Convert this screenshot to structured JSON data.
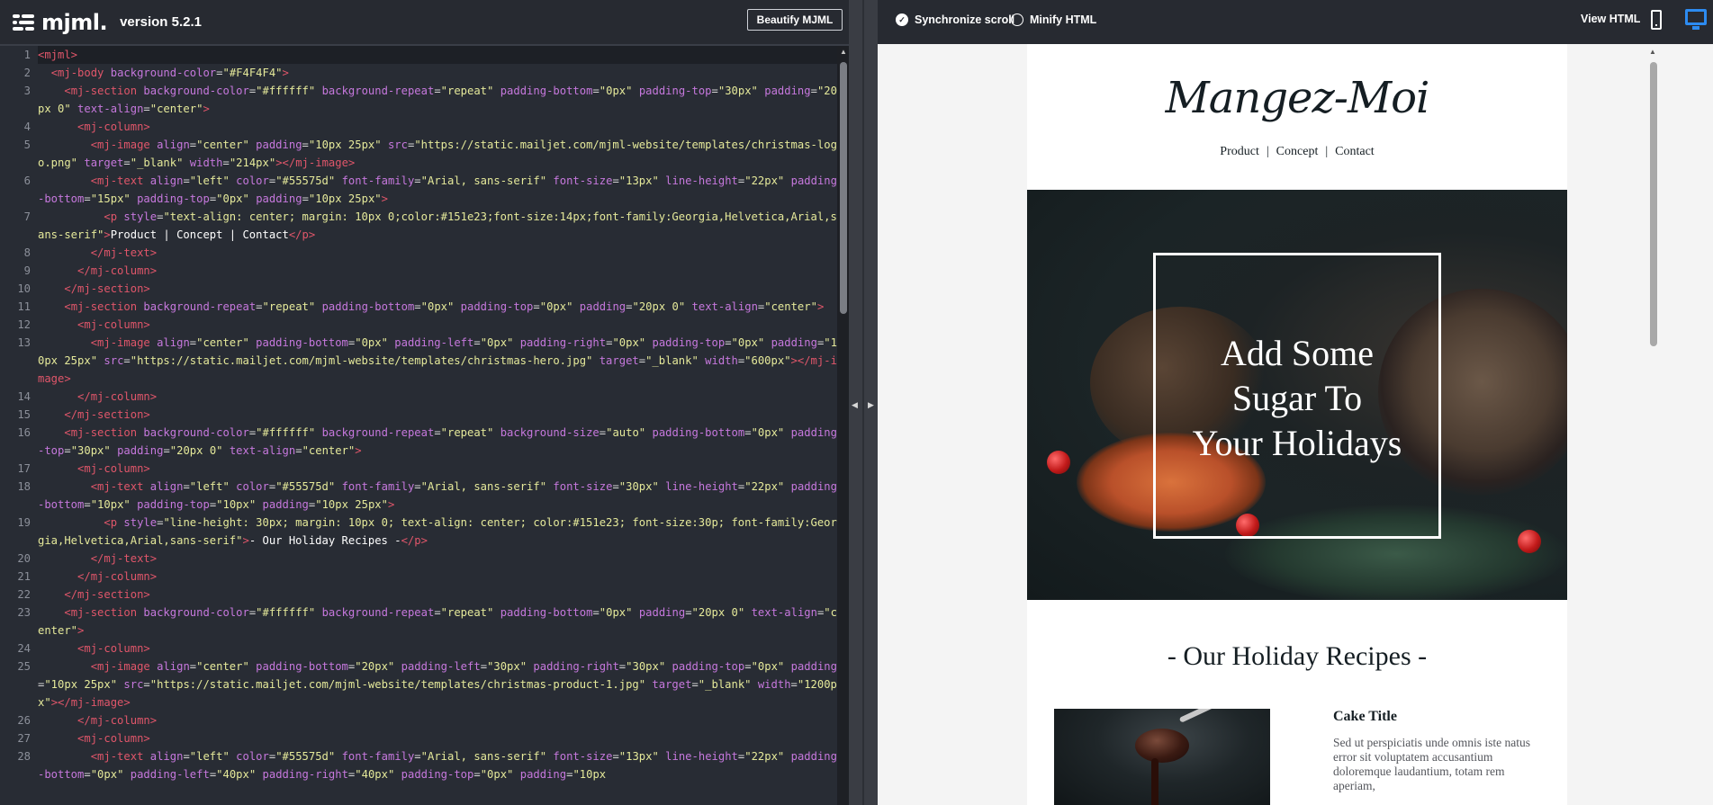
{
  "editor_header": {
    "logo_text": "mjml.",
    "version": "version 5.2.1",
    "beautify_label": "Beautify MJML"
  },
  "preview_header": {
    "sync_scroll_label": "Synchronize scroll",
    "sync_scroll_checked": true,
    "minify_label": "Minify HTML",
    "minify_checked": false,
    "view_html_label": "View HTML",
    "active_device": "desktop"
  },
  "editor": {
    "active_line": 1,
    "lines": [
      {
        "n": "1",
        "html": "<span class='t'>&lt;mjml&gt;</span>"
      },
      {
        "n": "2",
        "html": "  <span class='t'>&lt;mj-body</span> <span class='a'>background-color</span>=<span class='v'>\"#F4F4F4\"</span><span class='t'>&gt;</span>"
      },
      {
        "n": "3",
        "html": "    <span class='t'>&lt;mj-section</span> <span class='a'>background-color</span>=<span class='v'>\"#ffffff\"</span> <span class='a'>background-repeat</span>=<span class='v'>\"repeat\"</span> <span class='a'>padding-bottom</span>=<span class='v'>\"0px\"</span> <span class='a'>padding-top</span>=<span class='v'>\"30px\"</span> <span class='a'>padding</span>=<span class='v'>\"20px 0\"</span> <span class='a'>text-align</span>=<span class='v'>\"center\"</span><span class='t'>&gt;</span>"
      },
      {
        "n": "4",
        "html": "      <span class='t'>&lt;mj-column&gt;</span>"
      },
      {
        "n": "5",
        "html": "        <span class='t'>&lt;mj-image</span> <span class='a'>align</span>=<span class='v'>\"center\"</span> <span class='a'>padding</span>=<span class='v'>\"10px 25px\"</span> <span class='a'>src</span>=<span class='v'>\"https://static.mailjet.com/mjml-website/templates/christmas-logo.png\"</span> <span class='a'>target</span>=<span class='v'>\"_blank\"</span> <span class='a'>width</span>=<span class='v'>\"214px\"</span><span class='t'>&gt;&lt;/mj-image&gt;</span>"
      },
      {
        "n": "6",
        "html": "        <span class='t'>&lt;mj-text</span> <span class='a'>align</span>=<span class='v'>\"left\"</span> <span class='a'>color</span>=<span class='v'>\"#55575d\"</span> <span class='a'>font-family</span>=<span class='v'>\"Arial, sans-serif\"</span> <span class='a'>font-size</span>=<span class='v'>\"13px\"</span> <span class='a'>line-height</span>=<span class='v'>\"22px\"</span> <span class='a'>padding-bottom</span>=<span class='v'>\"15px\"</span> <span class='a'>padding-top</span>=<span class='v'>\"0px\"</span> <span class='a'>padding</span>=<span class='v'>\"10px 25px\"</span><span class='t'>&gt;</span>"
      },
      {
        "n": "7",
        "html": "          <span class='t'>&lt;p</span> <span class='a'>style</span>=<span class='v'>\"text-align: center; margin: 10px 0;color:#151e23;font-size:14px;font-family:Georgia,Helvetica,Arial,sans-serif\"</span><span class='t'>&gt;</span><span class='tx'>Product | Concept | Contact</span><span class='t'>&lt;/p&gt;</span>"
      },
      {
        "n": "8",
        "html": "        <span class='t'>&lt;/mj-text&gt;</span>"
      },
      {
        "n": "9",
        "html": "      <span class='t'>&lt;/mj-column&gt;</span>"
      },
      {
        "n": "10",
        "html": "    <span class='t'>&lt;/mj-section&gt;</span>"
      },
      {
        "n": "11",
        "html": "    <span class='t'>&lt;mj-section</span> <span class='a'>background-repeat</span>=<span class='v'>\"repeat\"</span> <span class='a'>padding-bottom</span>=<span class='v'>\"0px\"</span> <span class='a'>padding-top</span>=<span class='v'>\"0px\"</span> <span class='a'>padding</span>=<span class='v'>\"20px 0\"</span> <span class='a'>text-align</span>=<span class='v'>\"center\"</span><span class='t'>&gt;</span>"
      },
      {
        "n": "12",
        "html": "      <span class='t'>&lt;mj-column&gt;</span>"
      },
      {
        "n": "13",
        "html": "        <span class='t'>&lt;mj-image</span> <span class='a'>align</span>=<span class='v'>\"center\"</span> <span class='a'>padding-bottom</span>=<span class='v'>\"0px\"</span> <span class='a'>padding-left</span>=<span class='v'>\"0px\"</span> <span class='a'>padding-right</span>=<span class='v'>\"0px\"</span> <span class='a'>padding-top</span>=<span class='v'>\"0px\"</span> <span class='a'>padding</span>=<span class='v'>\"10px 25px\"</span> <span class='a'>src</span>=<span class='v'>\"https://static.mailjet.com/mjml-website/templates/christmas-hero.jpg\"</span> <span class='a'>target</span>=<span class='v'>\"_blank\"</span> <span class='a'>width</span>=<span class='v'>\"600px\"</span><span class='t'>&gt;&lt;/mj-image&gt;</span>"
      },
      {
        "n": "14",
        "html": "      <span class='t'>&lt;/mj-column&gt;</span>"
      },
      {
        "n": "15",
        "html": "    <span class='t'>&lt;/mj-section&gt;</span>"
      },
      {
        "n": "16",
        "html": "    <span class='t'>&lt;mj-section</span> <span class='a'>background-color</span>=<span class='v'>\"#ffffff\"</span> <span class='a'>background-repeat</span>=<span class='v'>\"repeat\"</span> <span class='a'>background-size</span>=<span class='v'>\"auto\"</span> <span class='a'>padding-bottom</span>=<span class='v'>\"0px\"</span> <span class='a'>padding-top</span>=<span class='v'>\"30px\"</span> <span class='a'>padding</span>=<span class='v'>\"20px 0\"</span> <span class='a'>text-align</span>=<span class='v'>\"center\"</span><span class='t'>&gt;</span>"
      },
      {
        "n": "17",
        "html": "      <span class='t'>&lt;mj-column&gt;</span>"
      },
      {
        "n": "18",
        "html": "        <span class='t'>&lt;mj-text</span> <span class='a'>align</span>=<span class='v'>\"left\"</span> <span class='a'>color</span>=<span class='v'>\"#55575d\"</span> <span class='a'>font-family</span>=<span class='v'>\"Arial, sans-serif\"</span> <span class='a'>font-size</span>=<span class='v'>\"30px\"</span> <span class='a'>line-height</span>=<span class='v'>\"22px\"</span> <span class='a'>padding-bottom</span>=<span class='v'>\"10px\"</span> <span class='a'>padding-top</span>=<span class='v'>\"10px\"</span> <span class='a'>padding</span>=<span class='v'>\"10px 25px\"</span><span class='t'>&gt;</span>"
      },
      {
        "n": "19",
        "html": "          <span class='t'>&lt;p</span> <span class='a'>style</span>=<span class='v'>\"line-height: 30px; margin: 10px 0; text-align: center; color:#151e23; font-size:30p; font-family:Georgia,Helvetica,Arial,sans-serif\"</span><span class='t'>&gt;</span><span class='tx'>- Our Holiday Recipes -</span><span class='t'>&lt;/p&gt;</span>"
      },
      {
        "n": "20",
        "html": "        <span class='t'>&lt;/mj-text&gt;</span>"
      },
      {
        "n": "21",
        "html": "      <span class='t'>&lt;/mj-column&gt;</span>"
      },
      {
        "n": "22",
        "html": "    <span class='t'>&lt;/mj-section&gt;</span>"
      },
      {
        "n": "23",
        "html": "    <span class='t'>&lt;mj-section</span> <span class='a'>background-color</span>=<span class='v'>\"#ffffff\"</span> <span class='a'>background-repeat</span>=<span class='v'>\"repeat\"</span> <span class='a'>padding-bottom</span>=<span class='v'>\"0px\"</span> <span class='a'>padding</span>=<span class='v'>\"20px 0\"</span> <span class='a'>text-align</span>=<span class='v'>\"center\"</span><span class='t'>&gt;</span>"
      },
      {
        "n": "24",
        "html": "      <span class='t'>&lt;mj-column&gt;</span>"
      },
      {
        "n": "25",
        "html": "        <span class='t'>&lt;mj-image</span> <span class='a'>align</span>=<span class='v'>\"center\"</span> <span class='a'>padding-bottom</span>=<span class='v'>\"20px\"</span> <span class='a'>padding-left</span>=<span class='v'>\"30px\"</span> <span class='a'>padding-right</span>=<span class='v'>\"30px\"</span> <span class='a'>padding-top</span>=<span class='v'>\"0px\"</span> <span class='a'>padding</span>=<span class='v'>\"10px 25px\"</span> <span class='a'>src</span>=<span class='v'>\"https://static.mailjet.com/mjml-website/templates/christmas-product-1.jpg\"</span> <span class='a'>target</span>=<span class='v'>\"_blank\"</span> <span class='a'>width</span>=<span class='v'>\"1200px\"</span><span class='t'>&gt;&lt;/mj-image&gt;</span>"
      },
      {
        "n": "26",
        "html": "      <span class='t'>&lt;/mj-column&gt;</span>"
      },
      {
        "n": "27",
        "html": "      <span class='t'>&lt;mj-column&gt;</span>"
      },
      {
        "n": "28",
        "html": "        <span class='t'>&lt;mj-text</span> <span class='a'>align</span>=<span class='v'>\"left\"</span> <span class='a'>color</span>=<span class='v'>\"#55575d\"</span> <span class='a'>font-family</span>=<span class='v'>\"Arial, sans-serif\"</span> <span class='a'>font-size</span>=<span class='v'>\"13px\"</span> <span class='a'>line-height</span>=<span class='v'>\"22px\"</span> <span class='a'>padding-bottom</span>=<span class='v'>\"0px\"</span> <span class='a'>padding-left</span>=<span class='v'>\"40px\"</span> <span class='a'>padding-right</span>=<span class='v'>\"40px\"</span> <span class='a'>padding-top</span>=<span class='v'>\"0px\"</span> <span class='a'>padding</span>=<span class='v'>\"10px</span>"
      }
    ]
  },
  "preview": {
    "brand": "Mangez-Moi",
    "nav": [
      "Product",
      "Concept",
      "Contact"
    ],
    "nav_separator": "|",
    "hero_title_lines": [
      "Add Some",
      "Sugar To",
      "Your Holidays"
    ],
    "recipes_title": "- Our Holiday Recipes -",
    "product_title": "Cake Title",
    "product_desc": "Sed ut perspiciatis unde omnis iste natus error sit voluptatem accusantium doloremque laudantium, totam rem aperiam,"
  },
  "colors": {
    "editor_bg": "#282c34",
    "tag": "#e0566a",
    "attr": "#c678dd",
    "value": "#e5e99a",
    "accent_device": "#2d8bf0",
    "email_text": "#151e23",
    "email_body_text": "#55575d",
    "preview_bg": "#f4f4f4"
  },
  "icons": {
    "logo": "mjml-logo-icon",
    "sync_scroll": "check-circle-icon",
    "minify": "radio-circle-icon",
    "mobile": "phone-icon",
    "desktop": "desktop-icon"
  }
}
